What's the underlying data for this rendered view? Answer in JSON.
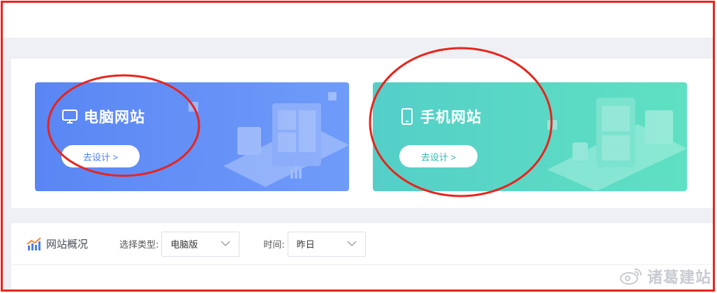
{
  "cards": {
    "pc": {
      "title": "电脑网站",
      "button_label": "去设计 >"
    },
    "mobile": {
      "title": "手机网站",
      "button_label": "去设计 >"
    }
  },
  "stats": {
    "title": "网站概况",
    "type_filter": {
      "label": "选择类型:",
      "value": "电脑版"
    },
    "time_filter": {
      "label": "时间:",
      "value": "昨日"
    }
  },
  "watermark": {
    "text": "诸葛建站"
  },
  "colors": {
    "pc_card": "#5a86f4",
    "mobile_card": "#54cfc8",
    "annotation_red": "#e8241c",
    "page_gray": "#eef0f4"
  },
  "icons": {
    "pc": "monitor-icon",
    "mobile": "phone-icon",
    "stats": "trend-chart-icon",
    "select": "chevron-down-icon",
    "watermark": "weibo-icon"
  }
}
